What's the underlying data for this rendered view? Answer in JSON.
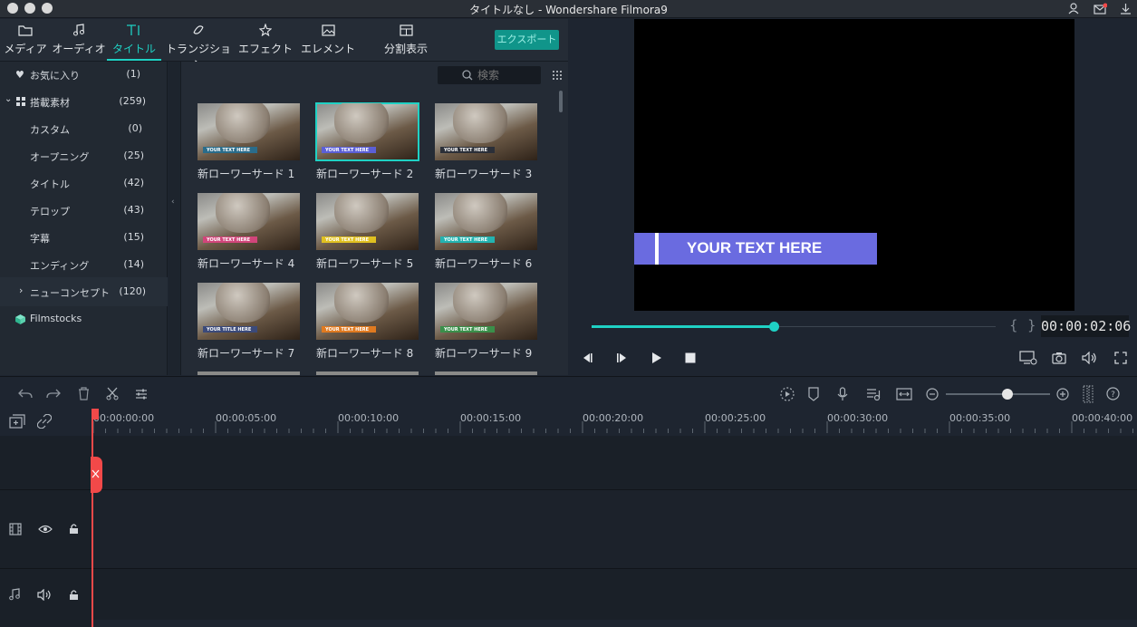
{
  "window": {
    "title": "タイトルなし - Wondershare Filmora9"
  },
  "tabs": [
    {
      "label": "メディア",
      "icon": "folder-icon"
    },
    {
      "label": "オーディオ",
      "icon": "music-note-icon"
    },
    {
      "label": "タイトル",
      "icon": "title-text-icon"
    },
    {
      "label": "トランジション",
      "icon": "transition-icon"
    },
    {
      "label": "エフェクト",
      "icon": "effects-icon"
    },
    {
      "label": "エレメント",
      "icon": "image-icon"
    },
    {
      "label": "分割表示",
      "icon": "split-screen-icon"
    }
  ],
  "export_label": "エクスポート",
  "sidebar": {
    "items": [
      {
        "label": "お気に入り",
        "count": "(1)"
      },
      {
        "label": "搭載素材",
        "count": "(259)"
      },
      {
        "label": "カスタム",
        "count": "(0)"
      },
      {
        "label": "オープニング",
        "count": "(25)"
      },
      {
        "label": "タイトル",
        "count": "(42)"
      },
      {
        "label": "テロップ",
        "count": "(43)"
      },
      {
        "label": "字幕",
        "count": "(15)"
      },
      {
        "label": "エンディング",
        "count": "(14)"
      },
      {
        "label": "ニューコンセプト",
        "count": "(120)"
      },
      {
        "label": "Filmstocks",
        "count": ""
      }
    ]
  },
  "search": {
    "placeholder": "検索"
  },
  "thumbnails": [
    {
      "label": "新ローワーサード 1",
      "band": "YOUR TEXT HERE",
      "color": "#2a6c8a"
    },
    {
      "label": "新ローワーサード 2",
      "band": "YOUR TEXT HERE",
      "color": "#5b5fd6"
    },
    {
      "label": "新ローワーサード 3",
      "band": "YOUR TEXT HERE",
      "color": "#2b2f38"
    },
    {
      "label": "新ローワーサード 4",
      "band": "YOUR TEXT HERE",
      "color": "#d1457a"
    },
    {
      "label": "新ローワーサード 5",
      "band": "YOUR TEXT HERE",
      "color": "#e0c020"
    },
    {
      "label": "新ローワーサード 6",
      "band": "YOUR TEXT HERE",
      "color": "#23b3b0"
    },
    {
      "label": "新ローワーサード 7",
      "band": "YOUR TITLE HERE",
      "color": "#3b4a7a"
    },
    {
      "label": "新ローワーサード 8",
      "band": "YOUR TEXT HERE",
      "color": "#e07a20"
    },
    {
      "label": "新ローワーサード 9",
      "band": "YOUR TEXT HERE",
      "color": "#3a8f4a"
    }
  ],
  "preview": {
    "overlay_text": "YOUR TEXT HERE",
    "accent": "#6a6be0",
    "progress": 0.45
  },
  "timecode": "00:00:02:06",
  "timeline": {
    "ticks": [
      "00:00:00:00",
      "00:00:05:00",
      "00:00:10:00",
      "00:00:15:00",
      "00:00:20:00",
      "00:00:25:00",
      "00:00:30:00",
      "00:00:35:00",
      "00:00:40:00"
    ]
  },
  "colors": {
    "accent": "#1fd1c4",
    "playhead": "#f24949"
  }
}
